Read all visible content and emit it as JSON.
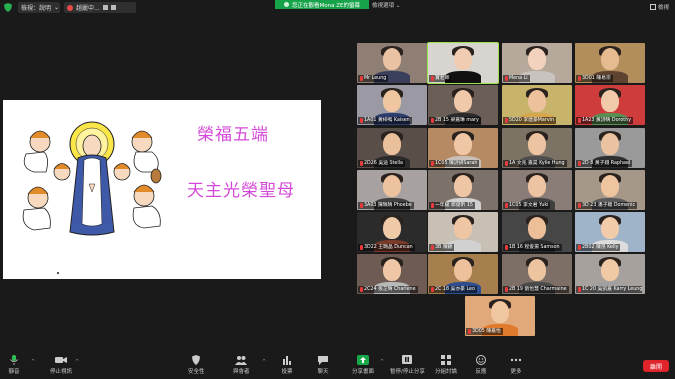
{
  "topbar": {
    "view_label": "檢視：說明",
    "share_label": "趙麗中...",
    "banner_text": "您正在觀看Mona ZE的螢幕",
    "view_options": "檢視選項 ⌄",
    "gallery_view": "檢視"
  },
  "slide": {
    "title": "榮福五端",
    "subtitle": "天主光榮聖母"
  },
  "participants": [
    {
      "name": "Mr Leung",
      "bg": "#8f7e73",
      "face": "#e9c2a4",
      "body": "#3a3f5c"
    },
    {
      "name": "寶老師",
      "bg": "#d8d4cf",
      "face": "#f0cdb2",
      "body": "#111111",
      "active": true
    },
    {
      "name": "Mena Li",
      "bg": "#b7a89c",
      "face": "#f2d2bc",
      "body": "#c9c3c0"
    },
    {
      "name": "3D01 陳易宗",
      "bg": "#b38e5d",
      "face": "#e6bb90",
      "body": "#5d4330"
    },
    {
      "name": "1A01 黃梓鳴 Kaisen",
      "bg": "#9b9aa4",
      "face": "#efc69f",
      "body": "#2d3c6b"
    },
    {
      "name": "2B 15 梁嘉琳 mary",
      "bg": "#6a5e56",
      "face": "#f0c9aa",
      "body": "#2a2a2a"
    },
    {
      "name": "5D20 李建豪Marvin",
      "bg": "#c7b46a",
      "face": "#ecc19b",
      "body": "#d7a54a"
    },
    {
      "name": "1A23 黃詩晴 Dorothy",
      "bg": "#ce3c3c",
      "face": "#f0caa9",
      "body": "#5a8f52"
    },
    {
      "name": "2D26 吳迪 Stella",
      "bg": "#5a4e48",
      "face": "#eabf9b",
      "body": "#2a2a2a"
    },
    {
      "name": "1C05 陳詩妍Sarah",
      "bg": "#b68a62",
      "face": "#efc7a5",
      "body": "#c8c0b8"
    },
    {
      "name": "1A 文兆 嘉昊 Kylie Hung",
      "bg": "#7d7364",
      "face": "#edc4a2",
      "body": "#4d4d4d"
    },
    {
      "name": "2D 8 黃子翔 Raphael",
      "bg": "#9a9a9a",
      "face": "#ecc3a0",
      "body": "#2f2f2f"
    },
    {
      "name": "3A03 陳珮晴 Phoebe",
      "bg": "#a7a2a0",
      "face": "#edc39f",
      "body": "#404040"
    },
    {
      "name": "一年級 郭俊昕 15",
      "bg": "#7d726a",
      "face": "#efc6a4",
      "body": "#d0d0d0"
    },
    {
      "name": "1C05 李文君 Yuki",
      "bg": "#8a7d78",
      "face": "#edc3a1",
      "body": "#3f3f3f"
    },
    {
      "name": "3D 23 潘子聰 Domenic",
      "bg": "#a69888",
      "face": "#efc5a0",
      "body": "#5a5a5a"
    },
    {
      "name": "3D22 王璐晶 Duncan",
      "bg": "#2b2b2b",
      "face": "#f0c9a7",
      "body": "#7a3a2a"
    },
    {
      "name": "3B 陳錦",
      "bg": "#c9c0b5",
      "face": "#efc6a3",
      "body": "#d1d1d1"
    },
    {
      "name": "1B 16 程俊揚 Samson",
      "bg": "#474646",
      "face": "#ecbf99",
      "body": "#2a2a2a"
    },
    {
      "name": "2B02 陳滉 Kelly",
      "bg": "#9fb4c8",
      "face": "#f1cbaa",
      "body": "#dcdcdc"
    },
    {
      "name": "2C24 張芷晴 Charlene",
      "bg": "#6e5c54",
      "face": "#efc7a6",
      "body": "#b8b8b8"
    },
    {
      "name": "2C 18 吳亦豪 Leo",
      "bg": "#a77f4f",
      "face": "#ecc19c",
      "body": "#2e4e8f"
    },
    {
      "name": "2B 19 劉怡慧 Charmaine",
      "bg": "#7d6e66",
      "face": "#edc4a0",
      "body": "#4a4a4a"
    },
    {
      "name": "1C 20 吳凱嘉 Karry Leung",
      "bg": "#a6a19d",
      "face": "#f0c9a5",
      "body": "#a0a0a0"
    },
    {
      "name": "3D05 陳嘉怡",
      "bg": "#e1a87a",
      "face": "#f0c7a0",
      "body": "#e07a2c"
    }
  ],
  "toolbar": {
    "mute": "靜音",
    "stop_video": "停止視訊",
    "security": "安全性",
    "participants": "與會者",
    "participants_count": "25",
    "polls": "投票",
    "chat": "聊天",
    "share": "分享畫面",
    "pause": "暫停/停止分享",
    "breakout": "分組討論",
    "reactions": "反應",
    "more": "更多",
    "end": "離開"
  }
}
